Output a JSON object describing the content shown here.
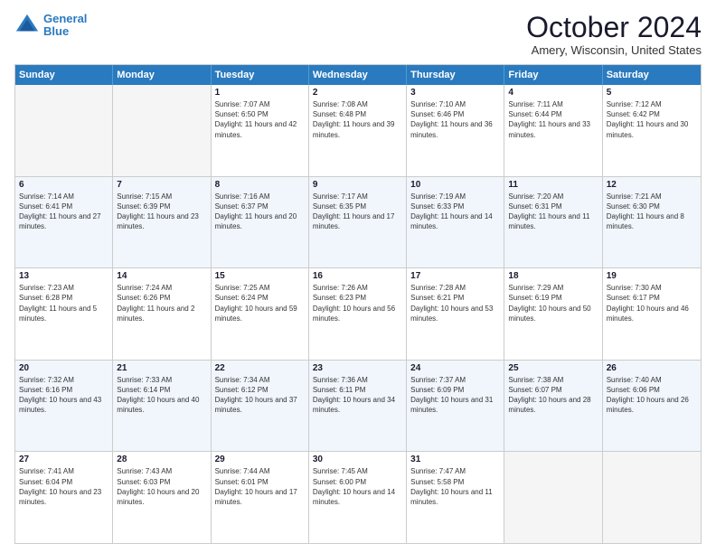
{
  "header": {
    "logo_line1": "General",
    "logo_line2": "Blue",
    "month": "October 2024",
    "location": "Amery, Wisconsin, United States"
  },
  "days_of_week": [
    "Sunday",
    "Monday",
    "Tuesday",
    "Wednesday",
    "Thursday",
    "Friday",
    "Saturday"
  ],
  "weeks": [
    [
      {
        "day": "",
        "sunrise": "",
        "sunset": "",
        "daylight": "",
        "empty": true
      },
      {
        "day": "",
        "sunrise": "",
        "sunset": "",
        "daylight": "",
        "empty": true
      },
      {
        "day": "1",
        "sunrise": "Sunrise: 7:07 AM",
        "sunset": "Sunset: 6:50 PM",
        "daylight": "Daylight: 11 hours and 42 minutes.",
        "empty": false
      },
      {
        "day": "2",
        "sunrise": "Sunrise: 7:08 AM",
        "sunset": "Sunset: 6:48 PM",
        "daylight": "Daylight: 11 hours and 39 minutes.",
        "empty": false
      },
      {
        "day": "3",
        "sunrise": "Sunrise: 7:10 AM",
        "sunset": "Sunset: 6:46 PM",
        "daylight": "Daylight: 11 hours and 36 minutes.",
        "empty": false
      },
      {
        "day": "4",
        "sunrise": "Sunrise: 7:11 AM",
        "sunset": "Sunset: 6:44 PM",
        "daylight": "Daylight: 11 hours and 33 minutes.",
        "empty": false
      },
      {
        "day": "5",
        "sunrise": "Sunrise: 7:12 AM",
        "sunset": "Sunset: 6:42 PM",
        "daylight": "Daylight: 11 hours and 30 minutes.",
        "empty": false
      }
    ],
    [
      {
        "day": "6",
        "sunrise": "Sunrise: 7:14 AM",
        "sunset": "Sunset: 6:41 PM",
        "daylight": "Daylight: 11 hours and 27 minutes.",
        "empty": false
      },
      {
        "day": "7",
        "sunrise": "Sunrise: 7:15 AM",
        "sunset": "Sunset: 6:39 PM",
        "daylight": "Daylight: 11 hours and 23 minutes.",
        "empty": false
      },
      {
        "day": "8",
        "sunrise": "Sunrise: 7:16 AM",
        "sunset": "Sunset: 6:37 PM",
        "daylight": "Daylight: 11 hours and 20 minutes.",
        "empty": false
      },
      {
        "day": "9",
        "sunrise": "Sunrise: 7:17 AM",
        "sunset": "Sunset: 6:35 PM",
        "daylight": "Daylight: 11 hours and 17 minutes.",
        "empty": false
      },
      {
        "day": "10",
        "sunrise": "Sunrise: 7:19 AM",
        "sunset": "Sunset: 6:33 PM",
        "daylight": "Daylight: 11 hours and 14 minutes.",
        "empty": false
      },
      {
        "day": "11",
        "sunrise": "Sunrise: 7:20 AM",
        "sunset": "Sunset: 6:31 PM",
        "daylight": "Daylight: 11 hours and 11 minutes.",
        "empty": false
      },
      {
        "day": "12",
        "sunrise": "Sunrise: 7:21 AM",
        "sunset": "Sunset: 6:30 PM",
        "daylight": "Daylight: 11 hours and 8 minutes.",
        "empty": false
      }
    ],
    [
      {
        "day": "13",
        "sunrise": "Sunrise: 7:23 AM",
        "sunset": "Sunset: 6:28 PM",
        "daylight": "Daylight: 11 hours and 5 minutes.",
        "empty": false
      },
      {
        "day": "14",
        "sunrise": "Sunrise: 7:24 AM",
        "sunset": "Sunset: 6:26 PM",
        "daylight": "Daylight: 11 hours and 2 minutes.",
        "empty": false
      },
      {
        "day": "15",
        "sunrise": "Sunrise: 7:25 AM",
        "sunset": "Sunset: 6:24 PM",
        "daylight": "Daylight: 10 hours and 59 minutes.",
        "empty": false
      },
      {
        "day": "16",
        "sunrise": "Sunrise: 7:26 AM",
        "sunset": "Sunset: 6:23 PM",
        "daylight": "Daylight: 10 hours and 56 minutes.",
        "empty": false
      },
      {
        "day": "17",
        "sunrise": "Sunrise: 7:28 AM",
        "sunset": "Sunset: 6:21 PM",
        "daylight": "Daylight: 10 hours and 53 minutes.",
        "empty": false
      },
      {
        "day": "18",
        "sunrise": "Sunrise: 7:29 AM",
        "sunset": "Sunset: 6:19 PM",
        "daylight": "Daylight: 10 hours and 50 minutes.",
        "empty": false
      },
      {
        "day": "19",
        "sunrise": "Sunrise: 7:30 AM",
        "sunset": "Sunset: 6:17 PM",
        "daylight": "Daylight: 10 hours and 46 minutes.",
        "empty": false
      }
    ],
    [
      {
        "day": "20",
        "sunrise": "Sunrise: 7:32 AM",
        "sunset": "Sunset: 6:16 PM",
        "daylight": "Daylight: 10 hours and 43 minutes.",
        "empty": false
      },
      {
        "day": "21",
        "sunrise": "Sunrise: 7:33 AM",
        "sunset": "Sunset: 6:14 PM",
        "daylight": "Daylight: 10 hours and 40 minutes.",
        "empty": false
      },
      {
        "day": "22",
        "sunrise": "Sunrise: 7:34 AM",
        "sunset": "Sunset: 6:12 PM",
        "daylight": "Daylight: 10 hours and 37 minutes.",
        "empty": false
      },
      {
        "day": "23",
        "sunrise": "Sunrise: 7:36 AM",
        "sunset": "Sunset: 6:11 PM",
        "daylight": "Daylight: 10 hours and 34 minutes.",
        "empty": false
      },
      {
        "day": "24",
        "sunrise": "Sunrise: 7:37 AM",
        "sunset": "Sunset: 6:09 PM",
        "daylight": "Daylight: 10 hours and 31 minutes.",
        "empty": false
      },
      {
        "day": "25",
        "sunrise": "Sunrise: 7:38 AM",
        "sunset": "Sunset: 6:07 PM",
        "daylight": "Daylight: 10 hours and 28 minutes.",
        "empty": false
      },
      {
        "day": "26",
        "sunrise": "Sunrise: 7:40 AM",
        "sunset": "Sunset: 6:06 PM",
        "daylight": "Daylight: 10 hours and 26 minutes.",
        "empty": false
      }
    ],
    [
      {
        "day": "27",
        "sunrise": "Sunrise: 7:41 AM",
        "sunset": "Sunset: 6:04 PM",
        "daylight": "Daylight: 10 hours and 23 minutes.",
        "empty": false
      },
      {
        "day": "28",
        "sunrise": "Sunrise: 7:43 AM",
        "sunset": "Sunset: 6:03 PM",
        "daylight": "Daylight: 10 hours and 20 minutes.",
        "empty": false
      },
      {
        "day": "29",
        "sunrise": "Sunrise: 7:44 AM",
        "sunset": "Sunset: 6:01 PM",
        "daylight": "Daylight: 10 hours and 17 minutes.",
        "empty": false
      },
      {
        "day": "30",
        "sunrise": "Sunrise: 7:45 AM",
        "sunset": "Sunset: 6:00 PM",
        "daylight": "Daylight: 10 hours and 14 minutes.",
        "empty": false
      },
      {
        "day": "31",
        "sunrise": "Sunrise: 7:47 AM",
        "sunset": "Sunset: 5:58 PM",
        "daylight": "Daylight: 10 hours and 11 minutes.",
        "empty": false
      },
      {
        "day": "",
        "sunrise": "",
        "sunset": "",
        "daylight": "",
        "empty": true
      },
      {
        "day": "",
        "sunrise": "",
        "sunset": "",
        "daylight": "",
        "empty": true
      }
    ]
  ]
}
